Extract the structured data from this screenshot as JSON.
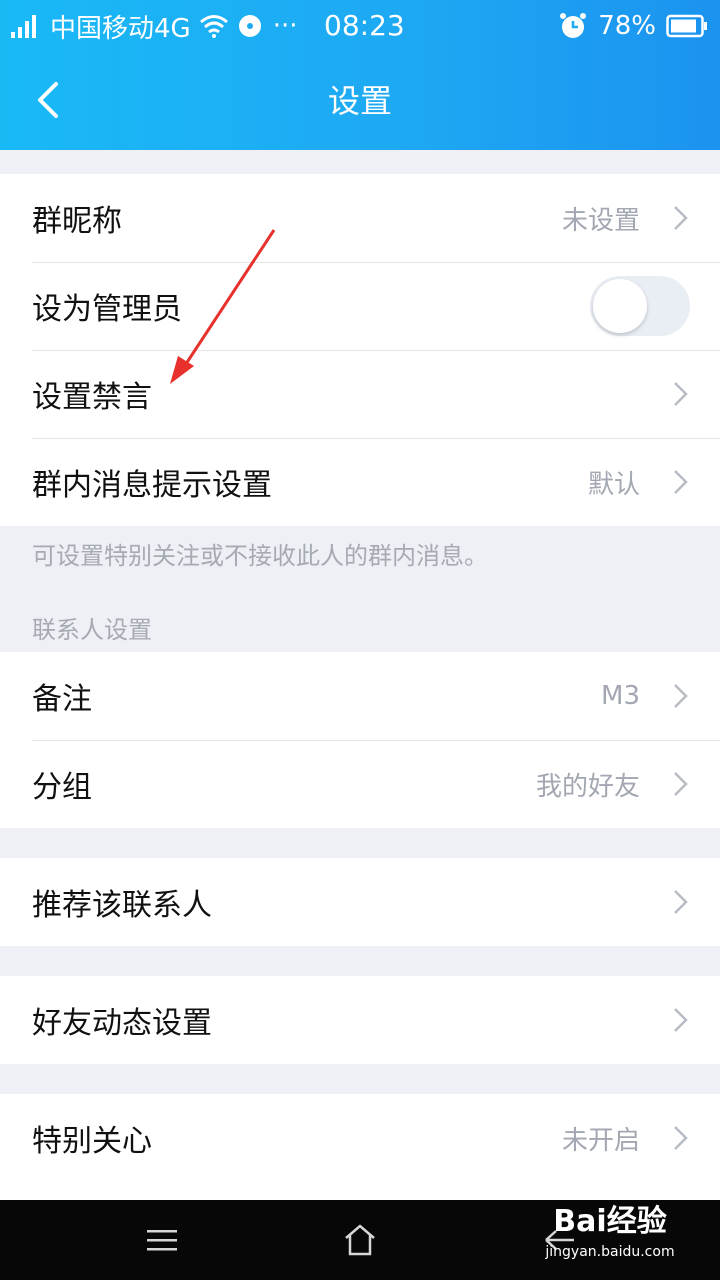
{
  "status_bar": {
    "carrier": "中国移动4G",
    "ellipsis": "···",
    "time": "08:23",
    "battery": "78%"
  },
  "nav": {
    "title": "设置"
  },
  "group_member": [
    {
      "label": "群昵称",
      "value": "未设置"
    },
    {
      "label": "设为管理员",
      "toggle": false
    },
    {
      "label": "设置禁言",
      "value": ""
    },
    {
      "label": "群内消息提示设置",
      "value": "默认"
    }
  ],
  "group_note": "可设置特别关注或不接收此人的群内消息。",
  "contact_section_title": "联系人设置",
  "contact": [
    {
      "label": "备注",
      "value": "M3"
    },
    {
      "label": "分组",
      "value": "我的好友"
    }
  ],
  "recommend": {
    "label": "推荐该联系人"
  },
  "feed": {
    "label": "好友动态设置"
  },
  "care": {
    "label": "特别关心",
    "value": "未开启"
  },
  "watermark": {
    "logo": "Bai经验",
    "url": "jingyan.baidu.com"
  },
  "colors": {
    "accent": "#1ea9f3",
    "annotation_arrow": "#e8312c"
  }
}
